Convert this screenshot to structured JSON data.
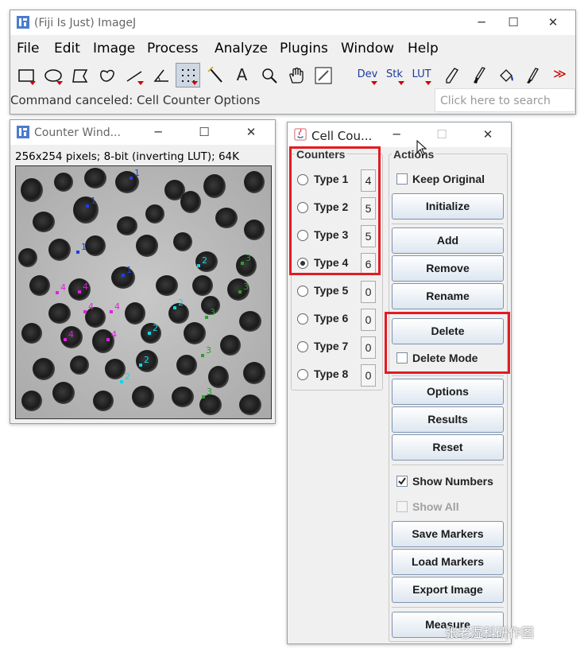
{
  "main_window": {
    "title": "(Fiji Is Just) ImageJ",
    "menus": [
      "File",
      "Edit",
      "Image",
      "Process",
      "Analyze",
      "Plugins",
      "Window",
      "Help"
    ],
    "tools": [
      {
        "icon": "rectangle-tool-icon"
      },
      {
        "icon": "oval-tool-icon"
      },
      {
        "icon": "polygon-tool-icon"
      },
      {
        "icon": "freehand-tool-icon"
      },
      {
        "icon": "line-tool-icon"
      },
      {
        "icon": "angle-tool-icon"
      },
      {
        "icon": "multipoint-tool-icon",
        "selected": true
      },
      {
        "icon": "wand-tool-icon"
      },
      {
        "icon": "text-tool-icon",
        "label": "A"
      },
      {
        "icon": "magnifier-tool-icon"
      },
      {
        "icon": "hand-tool-icon"
      },
      {
        "icon": "color-picker-tool-icon"
      },
      {
        "icon": "dev-menu-icon",
        "label": "Dev"
      },
      {
        "icon": "stk-menu-icon",
        "label": "Stk"
      },
      {
        "icon": "lut-menu-icon",
        "label": "LUT"
      },
      {
        "icon": "pencil-tool-icon"
      },
      {
        "icon": "paintbrush-tool-icon"
      },
      {
        "icon": "flood-fill-tool-icon"
      },
      {
        "icon": "spray-tool-icon"
      },
      {
        "icon": "more-tools-icon",
        "label": "≫"
      }
    ],
    "status": "Command canceled: Cell Counter Options",
    "search_placeholder": "Click here to search"
  },
  "counter_window": {
    "title": "Counter Wind...",
    "info": "256x254 pixels; 8-bit (inverting LUT); 64K",
    "markers": [
      {
        "type": 1,
        "label": "1"
      },
      {
        "type": 1,
        "label": "1"
      },
      {
        "type": 1,
        "label": "1"
      },
      {
        "type": 1,
        "label": "1"
      },
      {
        "type": 2,
        "label": "2"
      },
      {
        "type": 2,
        "label": "2"
      },
      {
        "type": 2,
        "label": "2"
      },
      {
        "type": 2,
        "label": "2"
      },
      {
        "type": 2,
        "label": "2"
      },
      {
        "type": 3,
        "label": "3"
      },
      {
        "type": 3,
        "label": "3"
      },
      {
        "type": 3,
        "label": "3"
      },
      {
        "type": 3,
        "label": "3"
      },
      {
        "type": 3,
        "label": "3"
      },
      {
        "type": 4,
        "label": "4"
      },
      {
        "type": 4,
        "label": "4"
      },
      {
        "type": 4,
        "label": "4"
      },
      {
        "type": 4,
        "label": "4"
      },
      {
        "type": 4,
        "label": "4"
      },
      {
        "type": 4,
        "label": "4"
      }
    ],
    "marker_colors": {
      "1": "#1f3fe0",
      "2": "#19d3e6",
      "3": "#2e9e2e",
      "4": "#e020e0"
    }
  },
  "cell_counter": {
    "title": "Cell Cou...",
    "counters_label": "Counters",
    "actions_label": "Actions",
    "counters": [
      {
        "label": "Type 1",
        "count": "4",
        "selected": false
      },
      {
        "label": "Type 2",
        "count": "5",
        "selected": false
      },
      {
        "label": "Type 3",
        "count": "5",
        "selected": false
      },
      {
        "label": "Type 4",
        "count": "6",
        "selected": true
      },
      {
        "label": "Type 5",
        "count": "0",
        "selected": false
      },
      {
        "label": "Type 6",
        "count": "0",
        "selected": false
      },
      {
        "label": "Type 7",
        "count": "0",
        "selected": false
      },
      {
        "label": "Type 8",
        "count": "0",
        "selected": false
      }
    ],
    "keep_original": "Keep Original",
    "initialize": "Initialize",
    "add": "Add",
    "remove": "Remove",
    "rename": "Rename",
    "delete": "Delete",
    "delete_mode": "Delete Mode",
    "options": "Options",
    "results": "Results",
    "reset": "Reset",
    "show_numbers": "Show Numbers",
    "show_numbers_checked": true,
    "show_all": "Show All",
    "save_markers": "Save Markers",
    "load_markers": "Load Markers",
    "export_image": "Export Image",
    "measure": "Measure"
  },
  "watermark": "张老湿科研作图",
  "highlight_color": "#e21b23"
}
